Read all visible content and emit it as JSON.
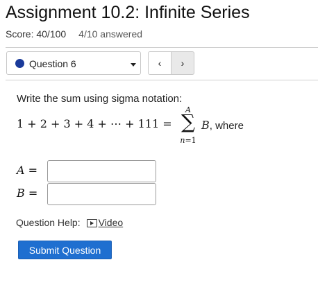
{
  "header": {
    "title": "Assignment 10.2: Infinite Series",
    "score": "Score: 40/100",
    "answered": "4/10 answered"
  },
  "question_nav": {
    "selected": "Question 6",
    "status_color": "#1a3a9a",
    "prev_label": "‹",
    "next_label": "›"
  },
  "problem": {
    "instruction": "Write the sum using sigma notation:",
    "expression": "1 + 2 + 3 + 4 + ⋯ + 111 =",
    "sigma_upper": "A",
    "sigma_symbol": "∑",
    "sigma_lower_var": "n",
    "sigma_lower_rest": "=1",
    "summand": "B",
    "where_text": ", where",
    "fields": [
      {
        "label": "A",
        "equals": " =",
        "value": ""
      },
      {
        "label": "B",
        "equals": " =",
        "value": ""
      }
    ]
  },
  "help": {
    "label": "Question Help:",
    "video_label": "Video",
    "video_icon": "play-video-icon"
  },
  "actions": {
    "submit_label": "Submit Question",
    "accent_color": "#1f6fd0"
  }
}
